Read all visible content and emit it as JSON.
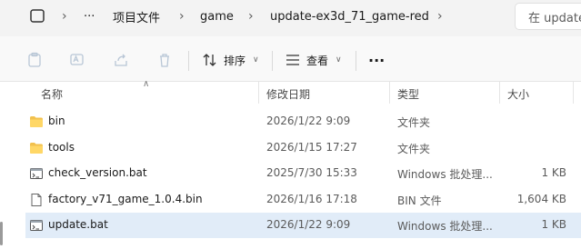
{
  "address": {
    "crumbs": [
      "项目文件",
      "game",
      "update-ex3d_71_game-red"
    ],
    "more": "···",
    "search_placeholder": "在 update"
  },
  "toolbar": {
    "sort_label": "排序",
    "view_label": "查看",
    "more_label": "···"
  },
  "columns": {
    "name": "名称",
    "modified": "修改日期",
    "type": "类型",
    "size": "大小"
  },
  "files": [
    {
      "name": "bin",
      "modified": "2026/1/22 9:09",
      "type": "文件夹",
      "size": "",
      "icon": "folder-icon"
    },
    {
      "name": "tools",
      "modified": "2026/1/15 17:27",
      "type": "文件夹",
      "size": "",
      "icon": "folder-icon"
    },
    {
      "name": "check_version.bat",
      "modified": "2025/7/30 15:33",
      "type": "Windows 批处理...",
      "size": "1 KB",
      "icon": "batch-file-icon"
    },
    {
      "name": "factory_v71_game_1.0.4.bin",
      "modified": "2026/1/16 17:18",
      "type": "BIN 文件",
      "size": "1,604 KB",
      "icon": "file-icon"
    },
    {
      "name": "update.bat",
      "modified": "2026/1/22 9:09",
      "type": "Windows 批处理...",
      "size": "1 KB",
      "icon": "batch-file-icon"
    }
  ],
  "selected_index": 4
}
